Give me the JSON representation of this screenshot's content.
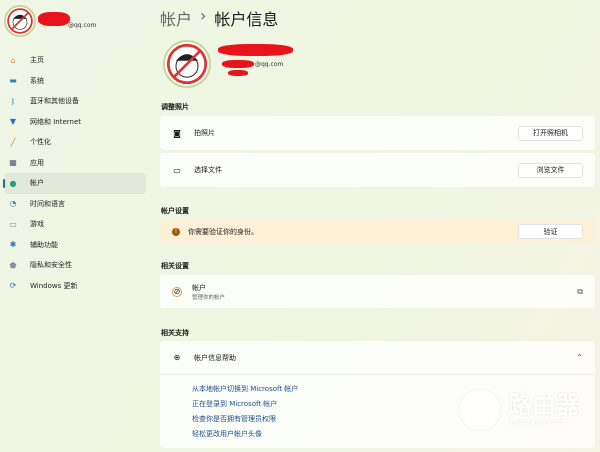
{
  "profile": {
    "email_suffix": "@qq.com"
  },
  "sidebar": {
    "items": [
      {
        "label": "主页",
        "icon": "home-icon",
        "color": "#e08a3c"
      },
      {
        "label": "系统",
        "icon": "monitor-icon",
        "color": "#2a86c9"
      },
      {
        "label": "蓝牙和其他设备",
        "icon": "bluetooth-icon",
        "color": "#1a73d6"
      },
      {
        "label": "网络和 Internet",
        "icon": "wifi-icon",
        "color": "#1a73d6"
      },
      {
        "label": "个性化",
        "icon": "brush-icon",
        "color": "#d88630"
      },
      {
        "label": "应用",
        "icon": "apps-icon",
        "color": "#4a5a78"
      },
      {
        "label": "帐户",
        "icon": "person-icon",
        "color": "#1fa07a"
      },
      {
        "label": "时间和语言",
        "icon": "globe-clock-icon",
        "color": "#2a86c9"
      },
      {
        "label": "游戏",
        "icon": "gamepad-icon",
        "color": "#7a88a8"
      },
      {
        "label": "辅助功能",
        "icon": "accessibility-icon",
        "color": "#1a73d6"
      },
      {
        "label": "隐私和安全性",
        "icon": "shield-icon",
        "color": "#8a8fa0"
      },
      {
        "label": "Windows 更新",
        "icon": "update-icon",
        "color": "#1a73d6"
      }
    ],
    "selected": 6
  },
  "header": {
    "crumb": "帐户",
    "sep": "›",
    "title": "帐户信息"
  },
  "main": {
    "email_suffix": "@qq.com",
    "photo": {
      "heading": "调整照片",
      "rows": [
        {
          "label": "拍照片",
          "button": "打开照相机"
        },
        {
          "label": "选择文件",
          "button": "浏览文件"
        }
      ]
    },
    "account_settings": {
      "heading": "帐户设置",
      "warning": "你需要验证你的身份。",
      "button": "验证"
    },
    "related": {
      "heading": "相关设置",
      "title": "帐户",
      "subtitle": "管理你的帐户"
    },
    "support": {
      "heading": "相关支持",
      "title": "帐户信息帮助",
      "links": [
        "从本地帐户切换到 Microsoft 帐户",
        "正在登录到 Microsoft 帐户",
        "检查你是否拥有管理员权限",
        "轻松更改用户帐户头像"
      ]
    }
  },
  "watermark": {
    "title": "路由器",
    "domain": "luyouqi.com"
  }
}
